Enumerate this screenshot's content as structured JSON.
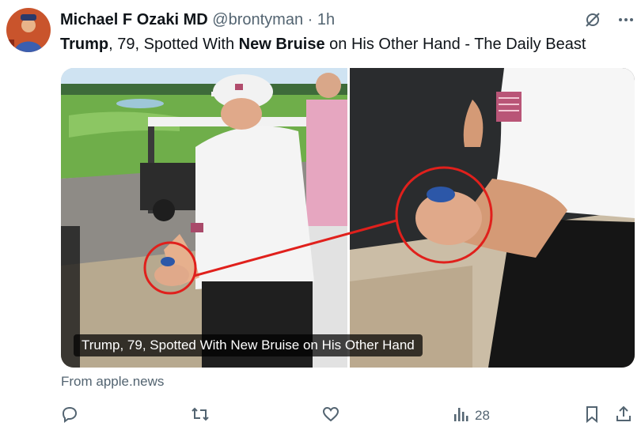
{
  "tweet": {
    "author_name": "Michael F Ozaki MD",
    "handle": "@brontyman",
    "separator": "·",
    "time": "1h",
    "text_parts": [
      "Trump",
      ", 79, Spotted With ",
      "New Bruise",
      " on His Other Hand - The Daily Beast"
    ]
  },
  "card": {
    "caption": "Trump, 79, Spotted With New Bruise on His Other Hand",
    "source": "From apple.news"
  },
  "actions": {
    "views_count": "28"
  },
  "icons": {
    "grok": "grok-icon",
    "more": "more-icon",
    "reply": "reply-icon",
    "retweet": "retweet-icon",
    "like": "like-icon",
    "views": "views-icon",
    "bookmark": "bookmark-icon",
    "share": "share-icon"
  },
  "colors": {
    "accent_red": "#e0201c",
    "muted": "#536471"
  }
}
